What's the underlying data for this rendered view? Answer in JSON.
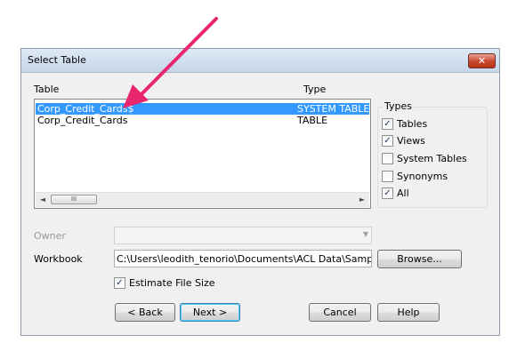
{
  "dialog": {
    "title": "Select Table",
    "close_symbol": "✕"
  },
  "list": {
    "col_table": "Table",
    "col_type": "Type",
    "rows": [
      {
        "name": "Corp_Credit_Cards$",
        "type": "SYSTEM TABLE",
        "selected": true
      },
      {
        "name": "Corp_Credit_Cards",
        "type": "TABLE",
        "selected": false
      }
    ],
    "scroll_left": "◄",
    "scroll_right": "►",
    "scroll_grip": "III"
  },
  "types": {
    "title": "Types",
    "items": [
      {
        "label": "Tables",
        "checked": true
      },
      {
        "label": "Views",
        "checked": true
      },
      {
        "label": "System Tables",
        "checked": false
      },
      {
        "label": "Synonyms",
        "checked": false
      },
      {
        "label": "All",
        "checked": true
      }
    ]
  },
  "owner": {
    "label": "Owner",
    "value": "",
    "arrow": "▼"
  },
  "workbook": {
    "label": "Workbook",
    "value": "C:\\Users\\leodith_tenorio\\Documents\\ACL Data\\Sample Data",
    "browse_label": "Browse..."
  },
  "estimate": {
    "label": "Estimate File Size",
    "checked": true
  },
  "buttons": {
    "back": "< Back",
    "next": "Next >",
    "cancel": "Cancel",
    "help": "Help"
  },
  "colors": {
    "selection": "#3399ff",
    "arrow": "#e8266e"
  }
}
